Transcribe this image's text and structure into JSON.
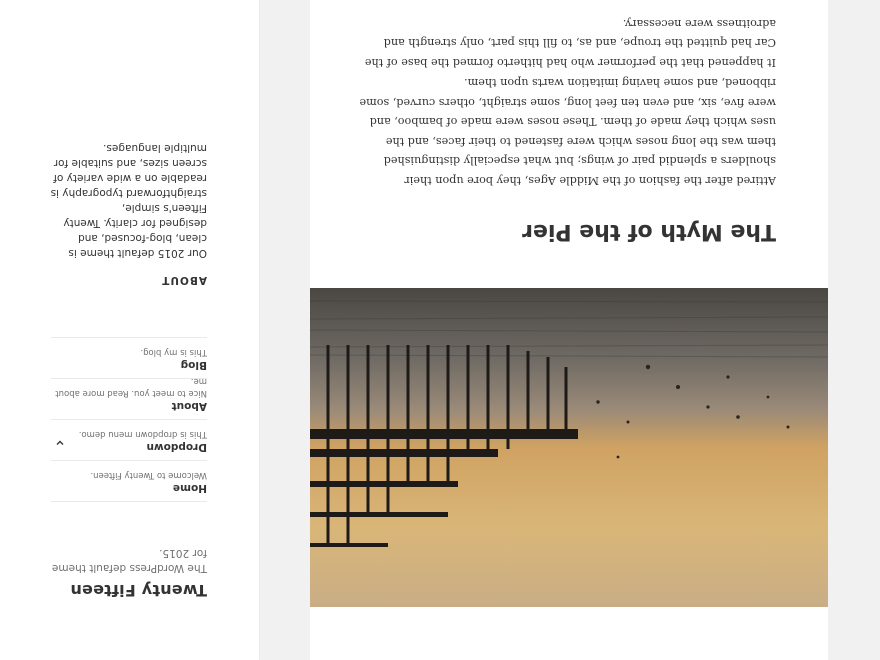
{
  "site": {
    "title": "Twenty Fifteen",
    "description": "The WordPress default theme for 2015."
  },
  "nav": [
    {
      "label": "Home",
      "sub": "Welcome to Twenty Fifteen."
    },
    {
      "label": "Dropdown",
      "sub": "This is dropdown menu demo."
    },
    {
      "label": "About",
      "sub": "Nice to meet you. Read more about me."
    },
    {
      "label": "Blog",
      "sub": "This is my blog."
    }
  ],
  "widget": {
    "title": "ABOUT",
    "text": "Our 2015 default theme is clean, blog-focused, and designed for clarity. Twenty Fifteen's simple, straightforward typography is readable on a wide variety of screen sizes, and suitable for multiple languages."
  },
  "post": {
    "title": "The Myth of the Pier",
    "paragraph_1": "Attired after the fashion of the Middle Ages, they bore upon their shoulders a splendid pair of wings; but what especially distinguished them was the long noses which were fastened to their faces, and the uses which they made of them. These noses were made of bamboo, and were five, six, and even ten feet long, some straight, others curved, some ribboned, and some having imitation warts upon them.",
    "paragraph_2": "It happened that the performer who had hitherto formed the base of the Car had quitted the troupe, and as, to fill this part, only strength and adroitness were necessary."
  },
  "colors": {
    "background": "#f1f1f1",
    "sidebar": "#ffffff",
    "card": "#ffffff",
    "text": "#333333",
    "muted": "#707070"
  }
}
